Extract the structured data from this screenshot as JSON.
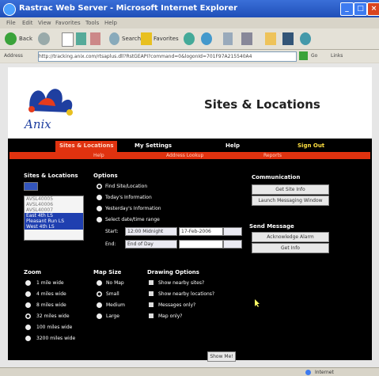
{
  "window": {
    "title": "Rastrac Web Server - Microsoft Internet Explorer"
  },
  "menu": [
    "File",
    "Edit",
    "View",
    "Favorites",
    "Tools",
    "Help"
  ],
  "toolbar": {
    "back": "Back",
    "search": "Search",
    "favorites": "Favorites"
  },
  "address": {
    "label": "Address",
    "url": "http://tracking.anix.com/rtsaplus.dll?RstGEAPI?command=0&logonId=701F97A215540A4",
    "go": "Go",
    "links": "Links"
  },
  "header": {
    "title": "Sites & Locations",
    "logo_text": "Anix"
  },
  "nav": {
    "tabs": [
      "Sites & Locations",
      "My Settings",
      "Help",
      "Sign Out"
    ],
    "sub": [
      "Help",
      "Address Lookup",
      "Reports"
    ]
  },
  "sites": {
    "label": "Sites & Locations",
    "items": [
      "AVSL40005",
      "AVSL40006",
      "AVSL40007",
      "East 4th LS",
      "Pleasant Run LS",
      "West 4th LS"
    ],
    "selected": [
      3,
      4,
      5
    ]
  },
  "options": {
    "label": "Options",
    "items": [
      "Find Site/Location",
      "Today's Information",
      "Yesterday's Information",
      "Select date/time range"
    ],
    "start_label": "Start:",
    "end_label": "End:",
    "start_time": "12:00 Midnight",
    "start_date": "17-Feb-2006",
    "end_time": "End of Day"
  },
  "communication": {
    "label": "Communication",
    "buttons": [
      "Get Site Info",
      "Launch Messaging Window"
    ]
  },
  "send_message": {
    "label": "Send Message",
    "buttons": [
      "Acknowledge Alarm",
      "Get Info"
    ]
  },
  "zoom": {
    "label": "Zoom",
    "items": [
      "1 mile wide",
      "4 miles wide",
      "8 miles wide",
      "32 miles wide",
      "100 miles wide",
      "3200 miles wide"
    ],
    "selected": 3
  },
  "map_size": {
    "label": "Map Size",
    "items": [
      "No Map",
      "Small",
      "Medium",
      "Large"
    ],
    "selected": 1
  },
  "drawing": {
    "label": "Drawing Options",
    "items": [
      "Show nearby sites?",
      "Show nearby locations?",
      "Messages only?",
      "Map only?"
    ]
  },
  "show_me": "Show Me!",
  "status": {
    "zone": "Internet"
  },
  "colors": {
    "title_bar": "#2458c8",
    "nav_red": "#e0320f",
    "page_bg": "#000000"
  }
}
